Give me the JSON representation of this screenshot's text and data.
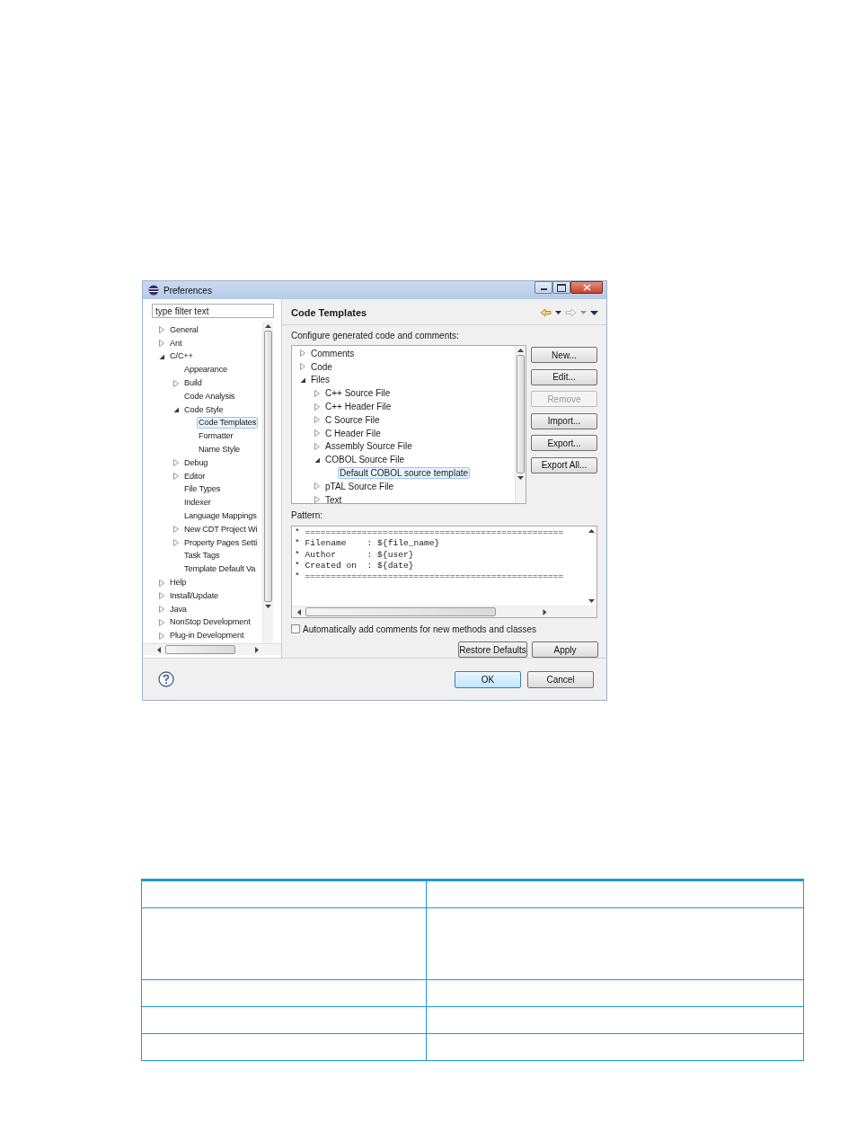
{
  "window": {
    "title": "Preferences"
  },
  "nav": {
    "filter": {
      "placeholder": "type filter text"
    },
    "tree": [
      {
        "label": "General",
        "kind": "folder",
        "expanded": false,
        "selected": false
      },
      {
        "label": "Ant",
        "kind": "folder",
        "expanded": false,
        "selected": false
      },
      {
        "label": "C/C++",
        "kind": "folder",
        "expanded": true,
        "selected": false,
        "children": [
          {
            "label": "Appearance",
            "kind": "leaf",
            "selected": false
          },
          {
            "label": "Build",
            "kind": "folder",
            "expanded": false,
            "selected": false
          },
          {
            "label": "Code Analysis",
            "kind": "leaf",
            "selected": false
          },
          {
            "label": "Code Style",
            "kind": "folder",
            "expanded": true,
            "selected": false,
            "children": [
              {
                "label": "Code Templates",
                "kind": "leaf",
                "selected": true
              },
              {
                "label": "Formatter",
                "kind": "leaf",
                "selected": false
              },
              {
                "label": "Name Style",
                "kind": "leaf",
                "selected": false
              }
            ]
          },
          {
            "label": "Debug",
            "kind": "folder",
            "expanded": false,
            "selected": false
          },
          {
            "label": "Editor",
            "kind": "folder",
            "expanded": false,
            "selected": false
          },
          {
            "label": "File Types",
            "kind": "leaf",
            "selected": false
          },
          {
            "label": "Indexer",
            "kind": "leaf",
            "selected": false
          },
          {
            "label": "Language Mappings",
            "kind": "leaf",
            "selected": false
          },
          {
            "label": "New CDT Project Wi",
            "kind": "folder",
            "expanded": false,
            "selected": false
          },
          {
            "label": "Property Pages Setti",
            "kind": "folder",
            "expanded": false,
            "selected": false
          },
          {
            "label": "Task Tags",
            "kind": "leaf",
            "selected": false
          },
          {
            "label": "Template Default Va",
            "kind": "leaf",
            "selected": false
          }
        ]
      },
      {
        "label": "Help",
        "kind": "folder",
        "expanded": false,
        "selected": false
      },
      {
        "label": "Install/Update",
        "kind": "folder",
        "expanded": false,
        "selected": false
      },
      {
        "label": "Java",
        "kind": "folder",
        "expanded": false,
        "selected": false
      },
      {
        "label": "NonStop Development",
        "kind": "folder",
        "expanded": false,
        "selected": false
      },
      {
        "label": "Plug-in Development",
        "kind": "folder",
        "expanded": false,
        "selected": false
      }
    ]
  },
  "page": {
    "title": "Code Templates",
    "description": "Configure generated code and comments:",
    "templates": [
      {
        "label": "Comments",
        "kind": "folder",
        "expanded": false,
        "selected": false
      },
      {
        "label": "Code",
        "kind": "folder",
        "expanded": false,
        "selected": false
      },
      {
        "label": "Files",
        "kind": "folder",
        "expanded": true,
        "selected": false,
        "children": [
          {
            "label": "C++ Source File",
            "kind": "folder",
            "expanded": false,
            "selected": false
          },
          {
            "label": "C++ Header File",
            "kind": "folder",
            "expanded": false,
            "selected": false
          },
          {
            "label": "C Source File",
            "kind": "folder",
            "expanded": false,
            "selected": false
          },
          {
            "label": "C Header File",
            "kind": "folder",
            "expanded": false,
            "selected": false
          },
          {
            "label": "Assembly Source File",
            "kind": "folder",
            "expanded": false,
            "selected": false
          },
          {
            "label": "COBOL Source File",
            "kind": "folder",
            "expanded": true,
            "selected": false,
            "children": [
              {
                "label": "Default COBOL source template",
                "kind": "leaf",
                "selected": true
              }
            ]
          },
          {
            "label": "pTAL Source File",
            "kind": "folder",
            "expanded": false,
            "selected": false
          },
          {
            "label": "Text",
            "kind": "folder",
            "expanded": false,
            "selected": false
          }
        ]
      }
    ],
    "buttons": [
      {
        "label": "New...",
        "disabled": false
      },
      {
        "label": "Edit...",
        "disabled": false
      },
      {
        "label": "Remove",
        "disabled": true
      },
      {
        "label": "Import...",
        "disabled": false
      },
      {
        "label": "Export...",
        "disabled": false
      },
      {
        "label": "Export All...",
        "disabled": false
      }
    ],
    "pattern_label": "Pattern:",
    "pattern": [
      "* ==================================================",
      "* Filename    : ${file_name}",
      "* Author      : ${user}",
      "* Created on  : ${date}",
      "* =================================================="
    ],
    "auto_comments": {
      "label": "Automatically add comments for new methods and classes",
      "checked": false
    },
    "restore": "Restore Defaults",
    "apply": "Apply"
  },
  "footer": {
    "buttons": [
      {
        "label": "OK",
        "default": true
      },
      {
        "label": "Cancel",
        "default": false
      }
    ]
  },
  "table": {
    "rows": [
      {
        "kind": "header"
      },
      {
        "kind": "tall"
      },
      {
        "kind": "normal"
      },
      {
        "kind": "normal"
      },
      {
        "kind": "normal"
      }
    ]
  }
}
